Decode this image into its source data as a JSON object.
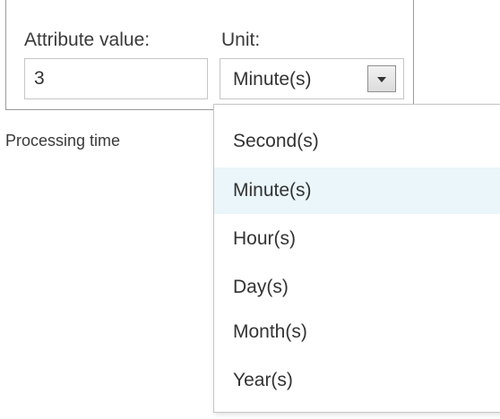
{
  "form": {
    "attribute_label": "Attribute value:",
    "attribute_value": "3",
    "unit_label": "Unit:",
    "unit_selected": "Minute(s)",
    "caption": "Processing time"
  },
  "dropdown": {
    "options": [
      "Second(s)",
      "Minute(s)",
      "Hour(s)",
      "Day(s)",
      "Month(s)",
      "Year(s)"
    ],
    "highlighted": "Minute(s)"
  },
  "icons": {
    "select_arrow": "chevron-down-icon"
  },
  "colors": {
    "highlight_bg": "#eaf6f9",
    "border": "#c6c6c6",
    "panel_border": "#9a9a9a",
    "text": "#333333"
  }
}
